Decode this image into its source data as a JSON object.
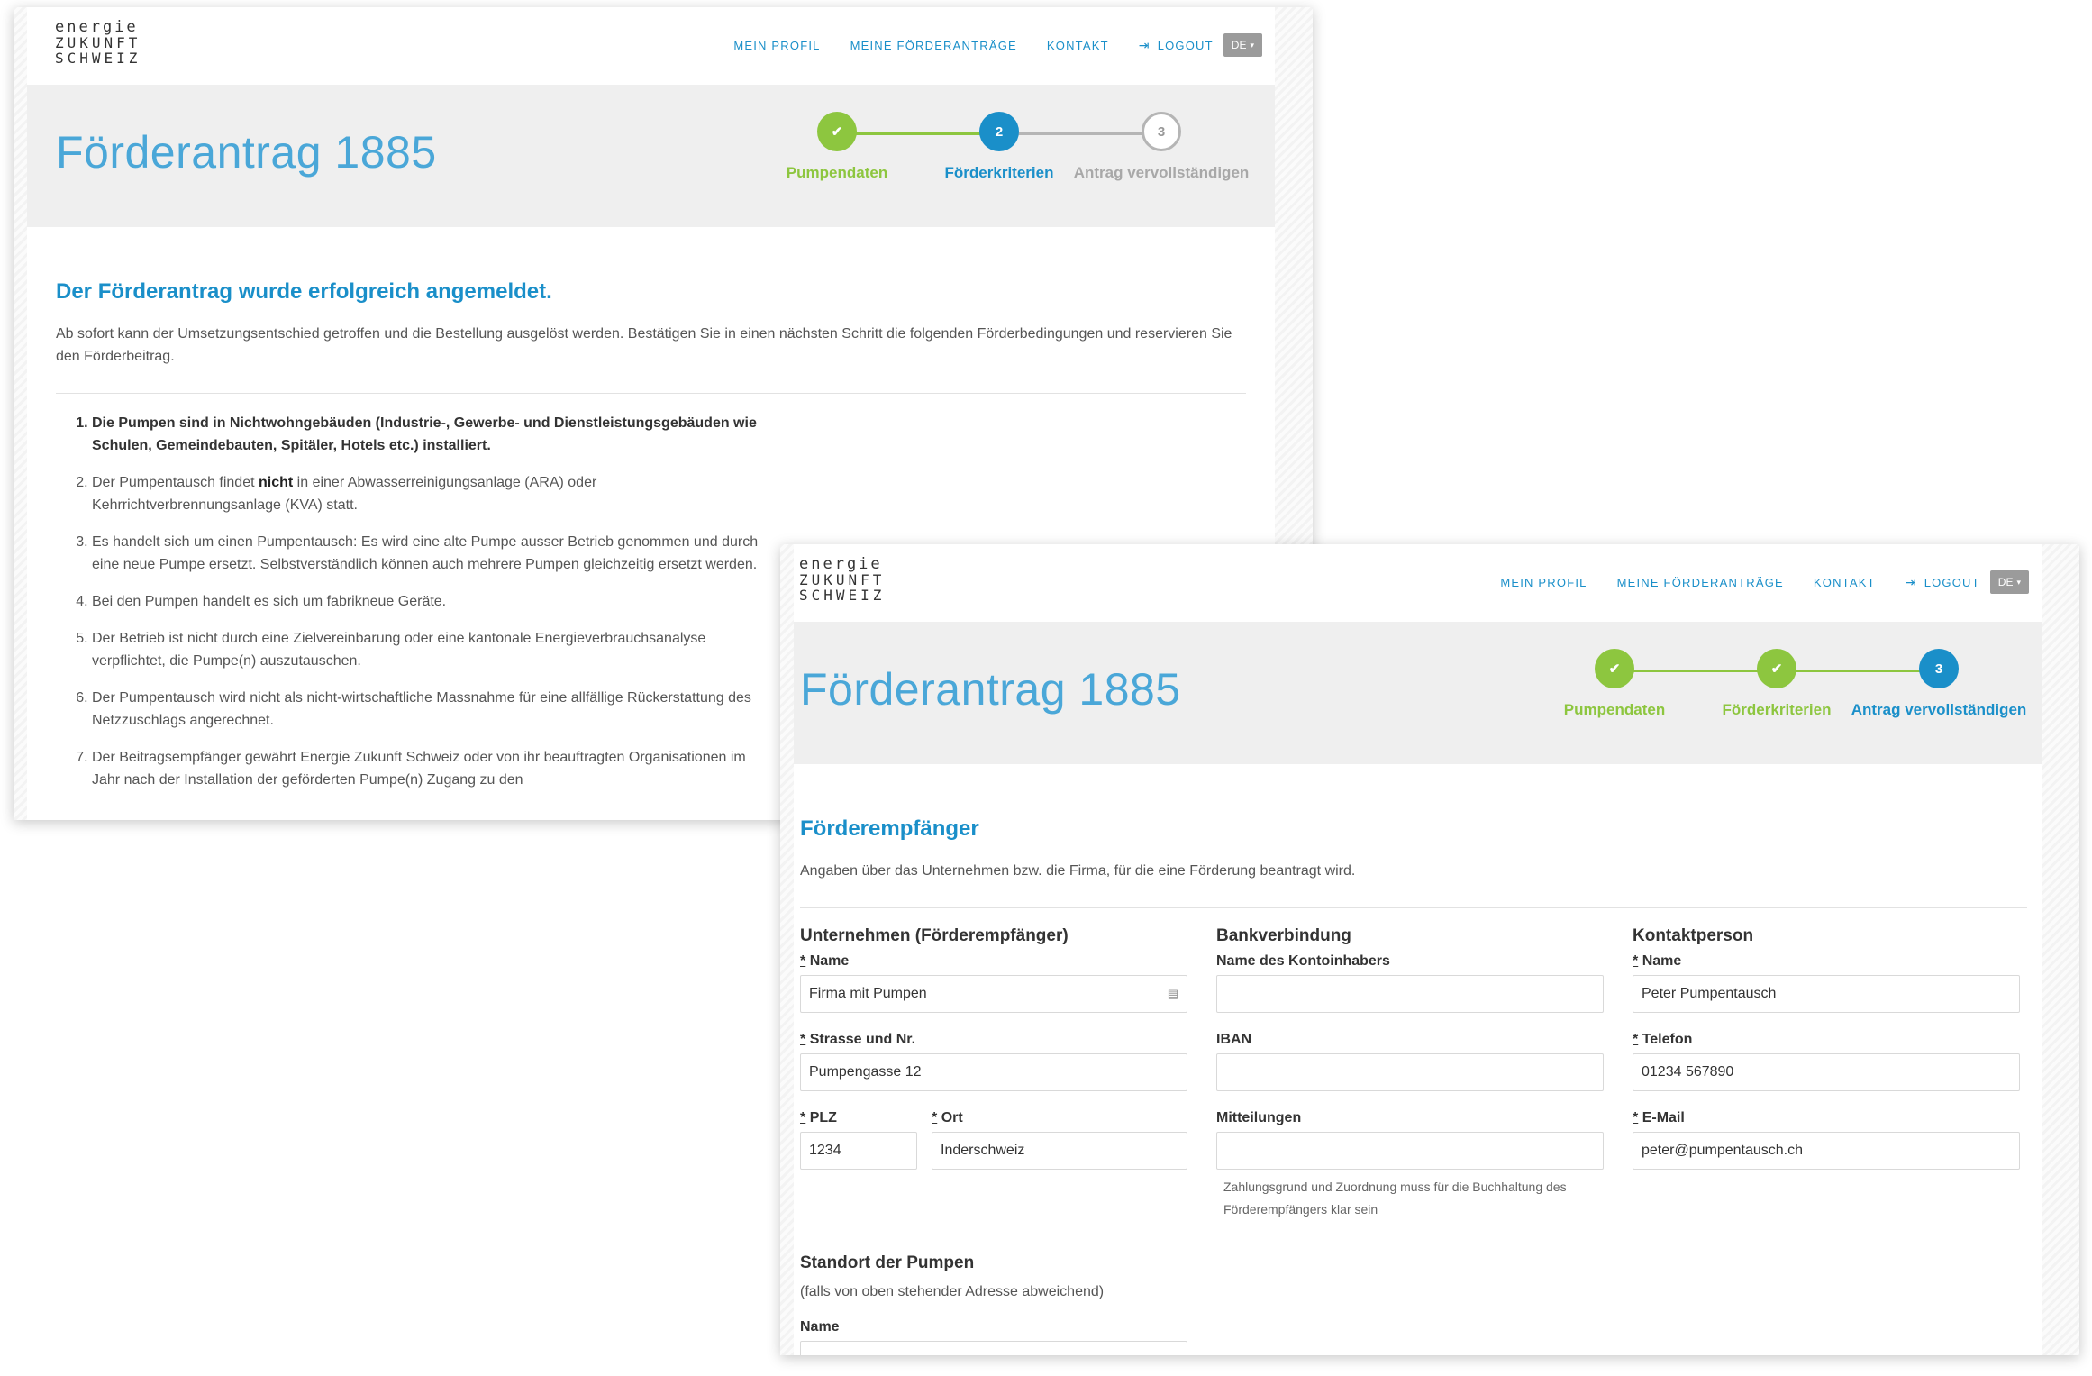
{
  "header": {
    "logo_lines": [
      "energie",
      "ZUKUNFT",
      "SCHWEIZ"
    ],
    "nav": [
      "MEIN PROFIL",
      "MEINE FÖRDERANTRÄGE",
      "KONTAKT"
    ],
    "logout": "LOGOUT",
    "lang": "DE"
  },
  "colors": {
    "accent_blue": "#1a8fc9",
    "accent_green": "#8dc63f",
    "band_bg": "#efefef"
  },
  "window1": {
    "title": "Förderantrag 1885",
    "steps": [
      {
        "label": "Pumpendaten",
        "num": "✔",
        "state": "done"
      },
      {
        "label": "Förderkriterien",
        "num": "2",
        "state": "active"
      },
      {
        "label": "Antrag vervollständigen",
        "num": "3",
        "state": "todo"
      }
    ],
    "heading": "Der Förderantrag wurde erfolgreich angemeldet.",
    "lead": "Ab sofort kann der Umsetzungsentschied getroffen und die Bestellung ausgelöst werden. Bestätigen Sie in einen nächsten Schritt die folgenden Förderbedingungen und reservieren Sie den Förderbeitrag.",
    "criteria": [
      "Die Pumpen sind in Nichtwohngebäuden (Industrie-, Gewerbe- und Dienstleistungsgebäuden wie Schulen, Gemeindebauten, Spitäler, Hotels etc.) installiert.",
      "Der Pumpentausch findet |nicht| in einer Abwasserreinigungsanlage (ARA) oder Kehrrichtverbrennungsanlage (KVA) statt.",
      "Es handelt sich um einen Pumpentausch: Es wird eine alte Pumpe ausser Betrieb genommen und durch eine neue Pumpe ersetzt. Selbstverständlich können auch mehrere Pumpen gleichzeitig ersetzt werden.",
      "Bei den Pumpen handelt es sich um fabrikneue Geräte.",
      "Der Betrieb ist nicht durch eine Zielvereinbarung oder eine kantonale Energieverbrauchsanalyse verpflichtet, die Pumpe(n) auszutauschen.",
      "Der Pumpentausch wird nicht als nicht-wirtschaftliche Massnahme für eine allfällige Rückerstattung des Netzzuschlags angerechnet.",
      "Der Beitragsempfänger gewährt Energie Zukunft Schweiz oder von ihr beauftragten Organisationen im Jahr nach der Installation der geförderten Pumpe(n) Zugang zu den"
    ]
  },
  "window2": {
    "title": "Förderantrag 1885",
    "steps": [
      {
        "label": "Pumpendaten",
        "num": "✔",
        "state": "done"
      },
      {
        "label": "Förderkriterien",
        "num": "✔",
        "state": "done"
      },
      {
        "label": "Antrag vervollständigen",
        "num": "3",
        "state": "active"
      }
    ],
    "heading": "Förderempfänger",
    "lead": "Angaben über das Unternehmen bzw. die Firma, für die eine Förderung beantragt wird.",
    "company": {
      "title": "Unternehmen (Förderempfänger)",
      "name_label": "Name",
      "name_value": "Firma mit Pumpen",
      "street_label": "Strasse und Nr.",
      "street_value": "Pumpengasse 12",
      "plz_label": "PLZ",
      "plz_value": "1234",
      "ort_label": "Ort",
      "ort_value": "Inderschweiz"
    },
    "bank": {
      "title": "Bankverbindung",
      "holder_label": "Name des Kontoinhabers",
      "holder_value": "",
      "iban_label": "IBAN",
      "iban_value": "",
      "msg_label": "Mitteilungen",
      "msg_value": "",
      "help": "Zahlungsgrund und Zuordnung muss für die Buchhaltung des Förderempfängers klar sein"
    },
    "contact": {
      "title": "Kontaktperson",
      "name_label": "Name",
      "name_value": "Peter Pumpentausch",
      "phone_label": "Telefon",
      "phone_value": "01234 567890",
      "email_label": "E-Mail",
      "email_value": "peter@pumpentausch.ch"
    },
    "location": {
      "title": "Standort der Pumpen",
      "sub": "(falls von oben stehender Adresse abweichend)",
      "name_label": "Name"
    }
  }
}
